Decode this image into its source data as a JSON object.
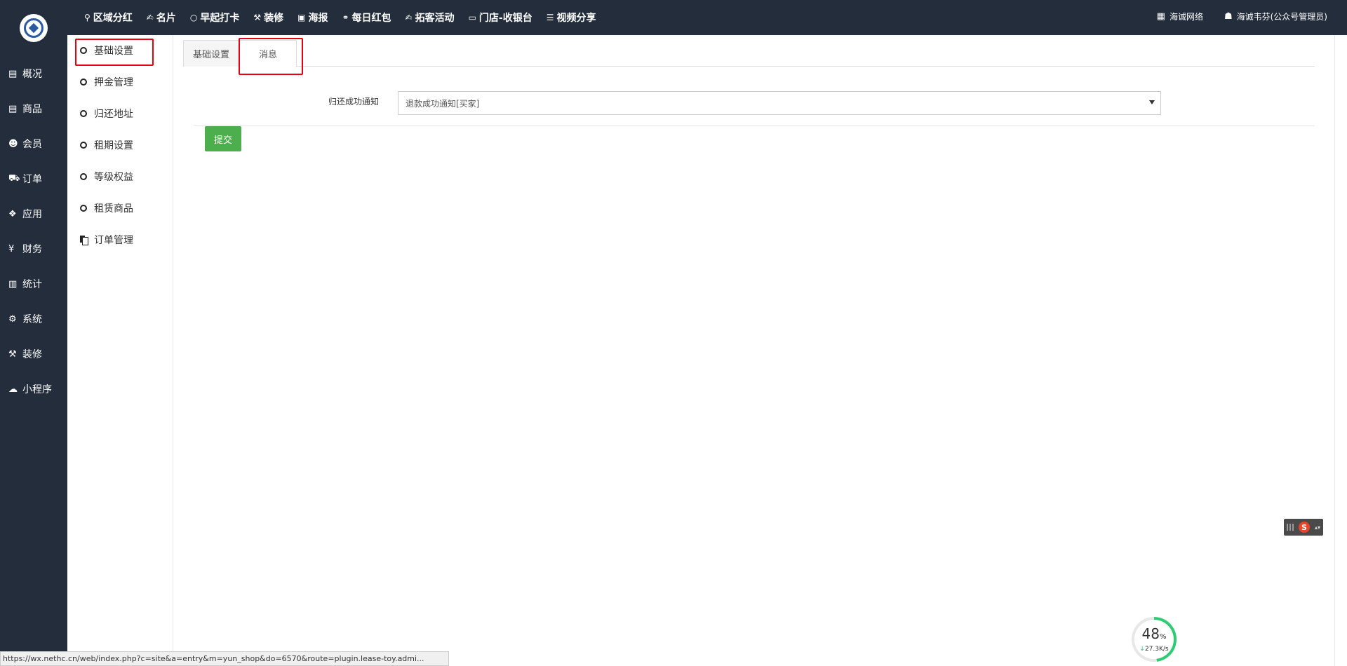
{
  "topnav": [
    {
      "icon": "tree-icon",
      "glyph": "⚲",
      "label": "区域分红"
    },
    {
      "icon": "handshake-icon",
      "glyph": "✍",
      "label": "名片"
    },
    {
      "icon": "circle-icon",
      "glyph": "○",
      "label": "早起打卡"
    },
    {
      "icon": "hammer-icon",
      "glyph": "⚒",
      "label": "装修"
    },
    {
      "icon": "image-icon",
      "glyph": "▣",
      "label": "海报"
    },
    {
      "icon": "link-icon",
      "glyph": "⚭",
      "label": "每日红包"
    },
    {
      "icon": "handshake-icon",
      "glyph": "✍",
      "label": "拓客活动"
    },
    {
      "icon": "cash-icon",
      "glyph": "▭",
      "label": "门店-收银台"
    },
    {
      "icon": "list-icon",
      "glyph": "☰",
      "label": "视频分享"
    }
  ],
  "topright": {
    "org_label": "海诚网络",
    "user_label": "海诚韦芬(公众号管理员)"
  },
  "sidebar": [
    {
      "icon": "archive-icon",
      "glyph": "▤",
      "label": "概况"
    },
    {
      "icon": "archive-icon",
      "glyph": "▤",
      "label": "商品"
    },
    {
      "icon": "users-icon",
      "glyph": "☻",
      "label": "会员"
    },
    {
      "icon": "cart-icon",
      "glyph": "⛟",
      "label": "订单"
    },
    {
      "icon": "cubes-icon",
      "glyph": "❖",
      "label": "应用"
    },
    {
      "icon": "yen-icon",
      "glyph": "¥",
      "label": "财务"
    },
    {
      "icon": "bar-chart-icon",
      "glyph": "▥",
      "label": "统计"
    },
    {
      "icon": "gears-icon",
      "glyph": "⚙",
      "label": "系统"
    },
    {
      "icon": "hammer-icon",
      "glyph": "⚒",
      "label": "装修"
    },
    {
      "icon": "wechat-icon",
      "glyph": "☁",
      "label": "小程序"
    }
  ],
  "subnav": [
    {
      "label": "基础设置"
    },
    {
      "label": "押金管理"
    },
    {
      "label": "归还地址"
    },
    {
      "label": "租期设置"
    },
    {
      "label": "等级权益"
    },
    {
      "label": "租赁商品"
    },
    {
      "label": "订单管理"
    }
  ],
  "tabs": {
    "basic": "基础设置",
    "message": "消息"
  },
  "form": {
    "label": "归还成功通知",
    "select_value": "退款成功通知[买家]",
    "submit_label": "提交"
  },
  "statusbar": {
    "url": "https://wx.nethc.cn/web/index.php?c=site&a=entry&m=yun_shop&do=6570&route=plugin.lease-toy.admi..."
  },
  "ime": {
    "label": "S"
  },
  "speed": {
    "percent": "48",
    "percent_unit": "%",
    "rate": "27.3K/s",
    "progress": 0.48
  },
  "colors": {
    "sidebar_bg": "#232d3c",
    "submit_bg": "#4cae4c",
    "highlight": "#e60012"
  }
}
